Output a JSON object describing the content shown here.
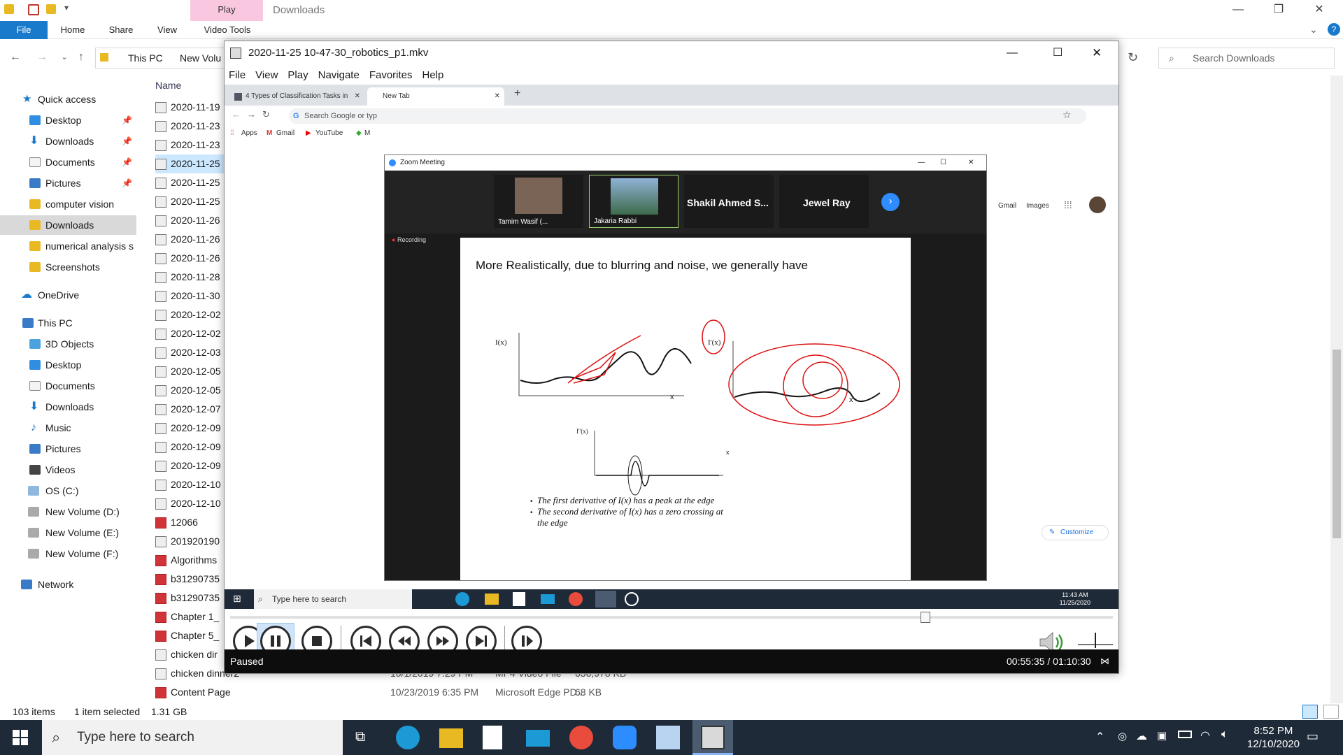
{
  "explorer": {
    "play_tab": "Play",
    "window_title": "Downloads",
    "ribbon_tabs": [
      "File",
      "Home",
      "Share",
      "View",
      "Video Tools"
    ],
    "address": {
      "crumb1": "This PC",
      "crumb2": "New Volu"
    },
    "search_placeholder": "Search Downloads",
    "nav": {
      "quick_access": "Quick access",
      "items": [
        {
          "label": "Desktop"
        },
        {
          "label": "Downloads"
        },
        {
          "label": "Documents"
        },
        {
          "label": "Pictures"
        },
        {
          "label": "computer vision"
        },
        {
          "label": "Downloads"
        },
        {
          "label": "numerical analysis s"
        },
        {
          "label": "Screenshots"
        }
      ],
      "onedrive": "OneDrive",
      "this_pc": "This PC",
      "pc_items": [
        {
          "label": "3D Objects"
        },
        {
          "label": "Desktop"
        },
        {
          "label": "Documents"
        },
        {
          "label": "Downloads"
        },
        {
          "label": "Music"
        },
        {
          "label": "Pictures"
        },
        {
          "label": "Videos"
        },
        {
          "label": "OS (C:)"
        },
        {
          "label": "New Volume (D:)"
        },
        {
          "label": "New Volume (E:)"
        },
        {
          "label": "New Volume (F:)"
        }
      ],
      "network": "Network"
    },
    "list": {
      "col_name": "Name",
      "rows": [
        {
          "name": "2020-11-19",
          "type": "video"
        },
        {
          "name": "2020-11-23",
          "type": "video"
        },
        {
          "name": "2020-11-23",
          "type": "video"
        },
        {
          "name": "2020-11-25",
          "type": "video"
        },
        {
          "name": "2020-11-25",
          "type": "video"
        },
        {
          "name": "2020-11-25",
          "type": "video"
        },
        {
          "name": "2020-11-26",
          "type": "video"
        },
        {
          "name": "2020-11-26",
          "type": "video"
        },
        {
          "name": "2020-11-26",
          "type": "video"
        },
        {
          "name": "2020-11-28",
          "type": "video"
        },
        {
          "name": "2020-11-30",
          "type": "video"
        },
        {
          "name": "2020-12-02",
          "type": "video"
        },
        {
          "name": "2020-12-02",
          "type": "video"
        },
        {
          "name": "2020-12-03",
          "type": "video"
        },
        {
          "name": "2020-12-05",
          "type": "video"
        },
        {
          "name": "2020-12-05",
          "type": "video"
        },
        {
          "name": "2020-12-07",
          "type": "video"
        },
        {
          "name": "2020-12-09",
          "type": "video"
        },
        {
          "name": "2020-12-09",
          "type": "video"
        },
        {
          "name": "2020-12-09",
          "type": "video"
        },
        {
          "name": "2020-12-10",
          "type": "video"
        },
        {
          "name": "2020-12-10",
          "type": "video"
        },
        {
          "name": "12066",
          "type": "pdf"
        },
        {
          "name": "201920190",
          "type": "video"
        },
        {
          "name": "Algorithms",
          "type": "pdf"
        },
        {
          "name": "b31290735",
          "type": "pdf"
        },
        {
          "name": "b31290735",
          "type": "pdf"
        },
        {
          "name": "Chapter 1_",
          "type": "pdf"
        },
        {
          "name": "Chapter 5_",
          "type": "pdf"
        },
        {
          "name": "chicken dir",
          "type": "video"
        },
        {
          "name": "chicken dinner2",
          "type": "video",
          "date": "10/1/2019 7:29 PM",
          "ftype": "MP4 Video File",
          "size": "636,978 KB"
        },
        {
          "name": "Content Page",
          "type": "pdf",
          "date": "10/23/2019 6:35 PM",
          "ftype": "Microsoft Edge PD...",
          "size": "68 KB"
        }
      ]
    },
    "status": {
      "count": "103 items",
      "selected": "1 item selected",
      "size": "1.31 GB"
    }
  },
  "player": {
    "title": "2020-11-25 10-47-30_robotics_p1.mkv",
    "menu": [
      "File",
      "View",
      "Play",
      "Navigate",
      "Favorites",
      "Help"
    ],
    "state": "Paused",
    "time": "00:55:35 / 01:10:30",
    "progress": 0.788
  },
  "video": {
    "browser": {
      "tab1": "4 Types of Classification Tasks in",
      "tab2": "New Tab",
      "omnibox": "Search Google or typ",
      "bookmarks": [
        "Apps",
        "Gmail",
        "YouTube",
        "M"
      ],
      "right_links": [
        "Gmail",
        "Images"
      ],
      "customize": "Customize"
    },
    "zoom": {
      "title": "Zoom Meeting",
      "participants": [
        {
          "name": "Tamim Wasif (..."
        },
        {
          "name": "Jakaria Rabbi"
        },
        {
          "name": "Shakil  Ahmed  S..."
        },
        {
          "name": "Jewel Ray"
        }
      ],
      "recording": "Recording"
    },
    "slide": {
      "title": "More Realistically, due to blurring and noise, we generally have",
      "label_ix": "I(x)",
      "label_dix": "I'(x)",
      "label_ddix": "I''(x)",
      "axis_x": "x",
      "bullet1": "The first derivative of I(x) has a peak at the edge",
      "bullet2": "The second derivative of I(x) has a zero crossing at",
      "bullet2b": "the edge"
    },
    "inner_taskbar": {
      "search": "Type here to search",
      "time": "11:43 AM",
      "date": "11/25/2020"
    }
  },
  "taskbar": {
    "search": "Type here to search",
    "time": "8:52 PM",
    "date": "12/10/2020"
  }
}
